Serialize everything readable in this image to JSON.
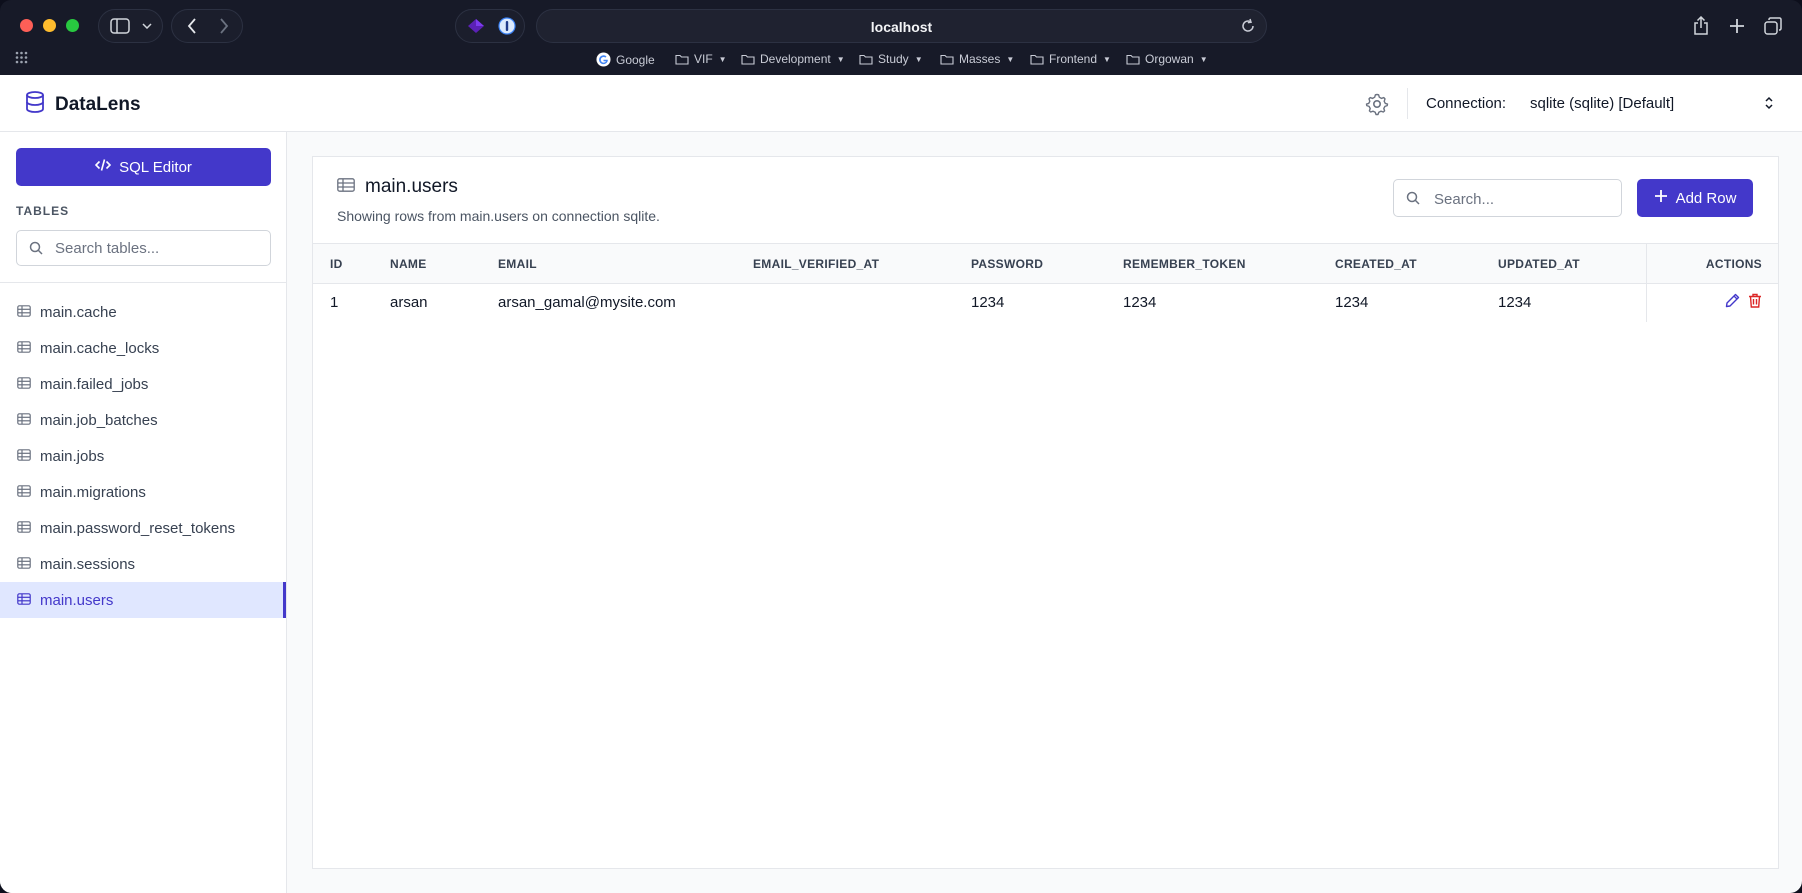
{
  "browser": {
    "url": "localhost",
    "bookmarks": [
      "Google",
      "VIF",
      "Development",
      "Study",
      "Masses",
      "Frontend",
      "Orgowan"
    ]
  },
  "header": {
    "app_name": "DataLens",
    "connection_label": "Connection:",
    "connection_value": "sqlite (sqlite) [Default]"
  },
  "sidebar": {
    "sql_editor_label": "SQL Editor",
    "tables_heading": "TABLES",
    "search_placeholder": "Search tables...",
    "tables": [
      "main.cache",
      "main.cache_locks",
      "main.failed_jobs",
      "main.job_batches",
      "main.jobs",
      "main.migrations",
      "main.password_reset_tokens",
      "main.sessions",
      "main.users"
    ],
    "active_table": "main.users"
  },
  "main": {
    "title": "main.users",
    "subtitle": "Showing rows from main.users on connection sqlite.",
    "search_placeholder": "Search...",
    "add_row_label": "Add Row",
    "columns": [
      "ID",
      "NAME",
      "EMAIL",
      "EMAIL_VERIFIED_AT",
      "PASSWORD",
      "REMEMBER_TOKEN",
      "CREATED_AT",
      "UPDATED_AT",
      "ACTIONS"
    ],
    "rows": [
      [
        "1",
        "arsan",
        "arsan_gamal@mysite.com",
        "",
        "1234",
        "1234",
        "1234",
        "1234"
      ]
    ]
  },
  "colors": {
    "accent": "#4338ca",
    "delete": "#dc2626",
    "active_bg": "#e0e7ff"
  }
}
